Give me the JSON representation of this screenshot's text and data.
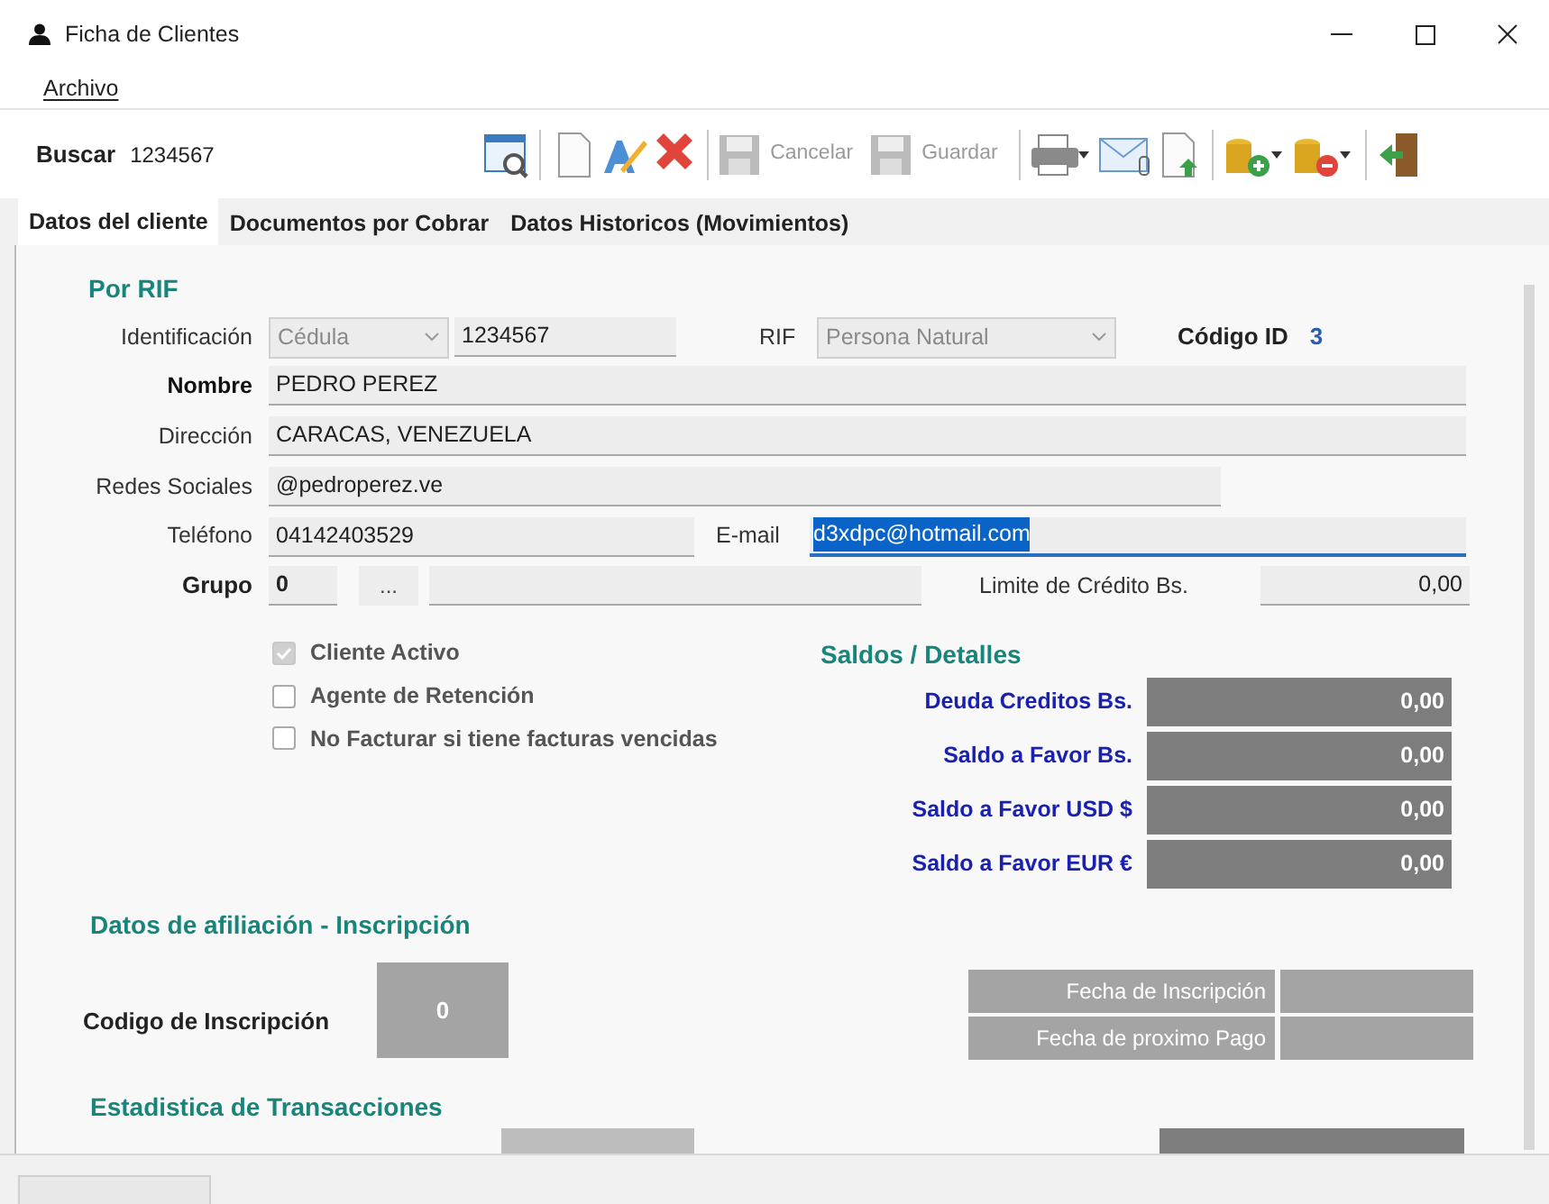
{
  "window": {
    "title": "Ficha de Clientes"
  },
  "menu": [
    "Archivo"
  ],
  "toolbar": {
    "search_label": "Buscar",
    "search_value": "1234567",
    "buttons": [
      {
        "label": "Cancelar",
        "disabled": true
      },
      {
        "label": "Guardar",
        "disabled": true
      }
    ]
  },
  "tabs": [
    {
      "label": "Datos del cliente",
      "selected": true
    },
    {
      "label": "Documentos por Cobrar",
      "selected": false
    },
    {
      "label": "Datos Historicos (Movimientos)",
      "selected": false
    }
  ],
  "por_rif": {
    "title": "Por RIF",
    "identificacion_label": "Identificación",
    "id_type": "Cédula",
    "id_number": "1234567",
    "rif_label": "RIF",
    "rif_type": "Persona Natural",
    "codigo_label": "Código ID",
    "codigo_value": "3"
  },
  "fields": [
    {
      "label": "Nombre",
      "value": "PEDRO PEREZ",
      "bold": true
    },
    {
      "label": "Dirección",
      "value": "CARACAS, VENEZUELA",
      "bold": false
    },
    {
      "label": "Redes Sociales",
      "value": "@pedroperez.ve",
      "bold": false
    }
  ],
  "telefono": {
    "label": "Teléfono",
    "value": "04142403529"
  },
  "email": {
    "label": "E-mail",
    "value": "d3xdpc@hotmail.com",
    "selected": true
  },
  "grupo": {
    "label": "Grupo",
    "value": "0",
    "button": "...",
    "credit_label": "Limite de Crédito Bs.",
    "credit_value": "0,00"
  },
  "checkboxes": [
    {
      "label": "Cliente Activo",
      "checked": true,
      "disabled": true
    },
    {
      "label": "Agente de Retención",
      "checked": false,
      "disabled": false
    },
    {
      "label": "No Facturar si tiene facturas vencidas",
      "checked": false,
      "disabled": false
    }
  ],
  "saldos": {
    "title": "Saldos / Detalles",
    "rows": [
      {
        "label": "Deuda Creditos Bs.",
        "value": "0,00"
      },
      {
        "label": "Saldo a Favor Bs.",
        "value": "0,00"
      },
      {
        "label": "Saldo a Favor USD $",
        "value": "0,00"
      },
      {
        "label": "Saldo a Favor EUR €",
        "value": "0,00"
      }
    ]
  },
  "afiliacion": {
    "title": "Datos de afiliación - Inscripción",
    "codigo_label": "Codigo de Inscripción",
    "codigo_value": "0",
    "fechas": [
      "Fecha de Inscripción",
      "Fecha de proximo Pago"
    ]
  },
  "estadistica": {
    "title": "Estadistica de Transacciones"
  }
}
